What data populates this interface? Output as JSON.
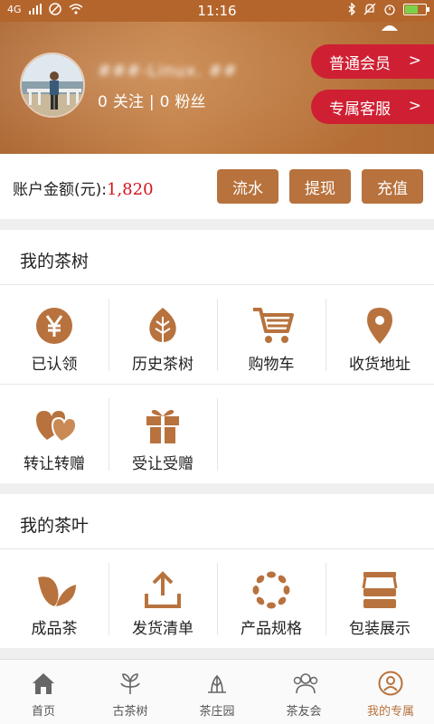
{
  "status_bar": {
    "signal": "4G",
    "time": "11:16"
  },
  "profile": {
    "username": "###-Linux. ##",
    "following_count": "0",
    "following_label": "关注",
    "separator": "|",
    "fans_count": "0",
    "fans_label": "粉丝",
    "member_button": "普通会员",
    "service_button": "专属客服",
    "chevron": ">"
  },
  "account": {
    "label": "账户金额(元):",
    "value": "1,820",
    "flow_button": "流水",
    "withdraw_button": "提现",
    "recharge_button": "充值"
  },
  "tea_tree_section": {
    "title": "我的茶树",
    "items": [
      {
        "label": "已认领",
        "icon": "yen-icon"
      },
      {
        "label": "历史茶树",
        "icon": "leaf-icon"
      },
      {
        "label": "购物车",
        "icon": "cart-icon"
      },
      {
        "label": "收货地址",
        "icon": "location-pin-icon"
      },
      {
        "label": "转让转赠",
        "icon": "hearts-icon"
      },
      {
        "label": "受让受赠",
        "icon": "gift-icon"
      }
    ]
  },
  "tea_leaf_section": {
    "title": "我的茶叶",
    "items": [
      {
        "label": "成品茶",
        "icon": "tea-leaves-icon"
      },
      {
        "label": "发货清单",
        "icon": "upload-icon"
      },
      {
        "label": "产品规格",
        "icon": "ring-icon"
      },
      {
        "label": "包装展示",
        "icon": "stack-icon"
      }
    ]
  },
  "tab_bar": {
    "tabs": [
      {
        "label": "首页",
        "icon": "home-icon"
      },
      {
        "label": "古茶树",
        "icon": "tree-icon"
      },
      {
        "label": "茶庄园",
        "icon": "manor-icon"
      },
      {
        "label": "茶友会",
        "icon": "friends-icon"
      },
      {
        "label": "我的专属",
        "icon": "person-icon",
        "active": true
      }
    ]
  },
  "colors": {
    "brand_brown": "#b8723d",
    "header_brown": "#b06a33",
    "accent_red": "#cf2033",
    "amount_red": "#d4141e"
  }
}
